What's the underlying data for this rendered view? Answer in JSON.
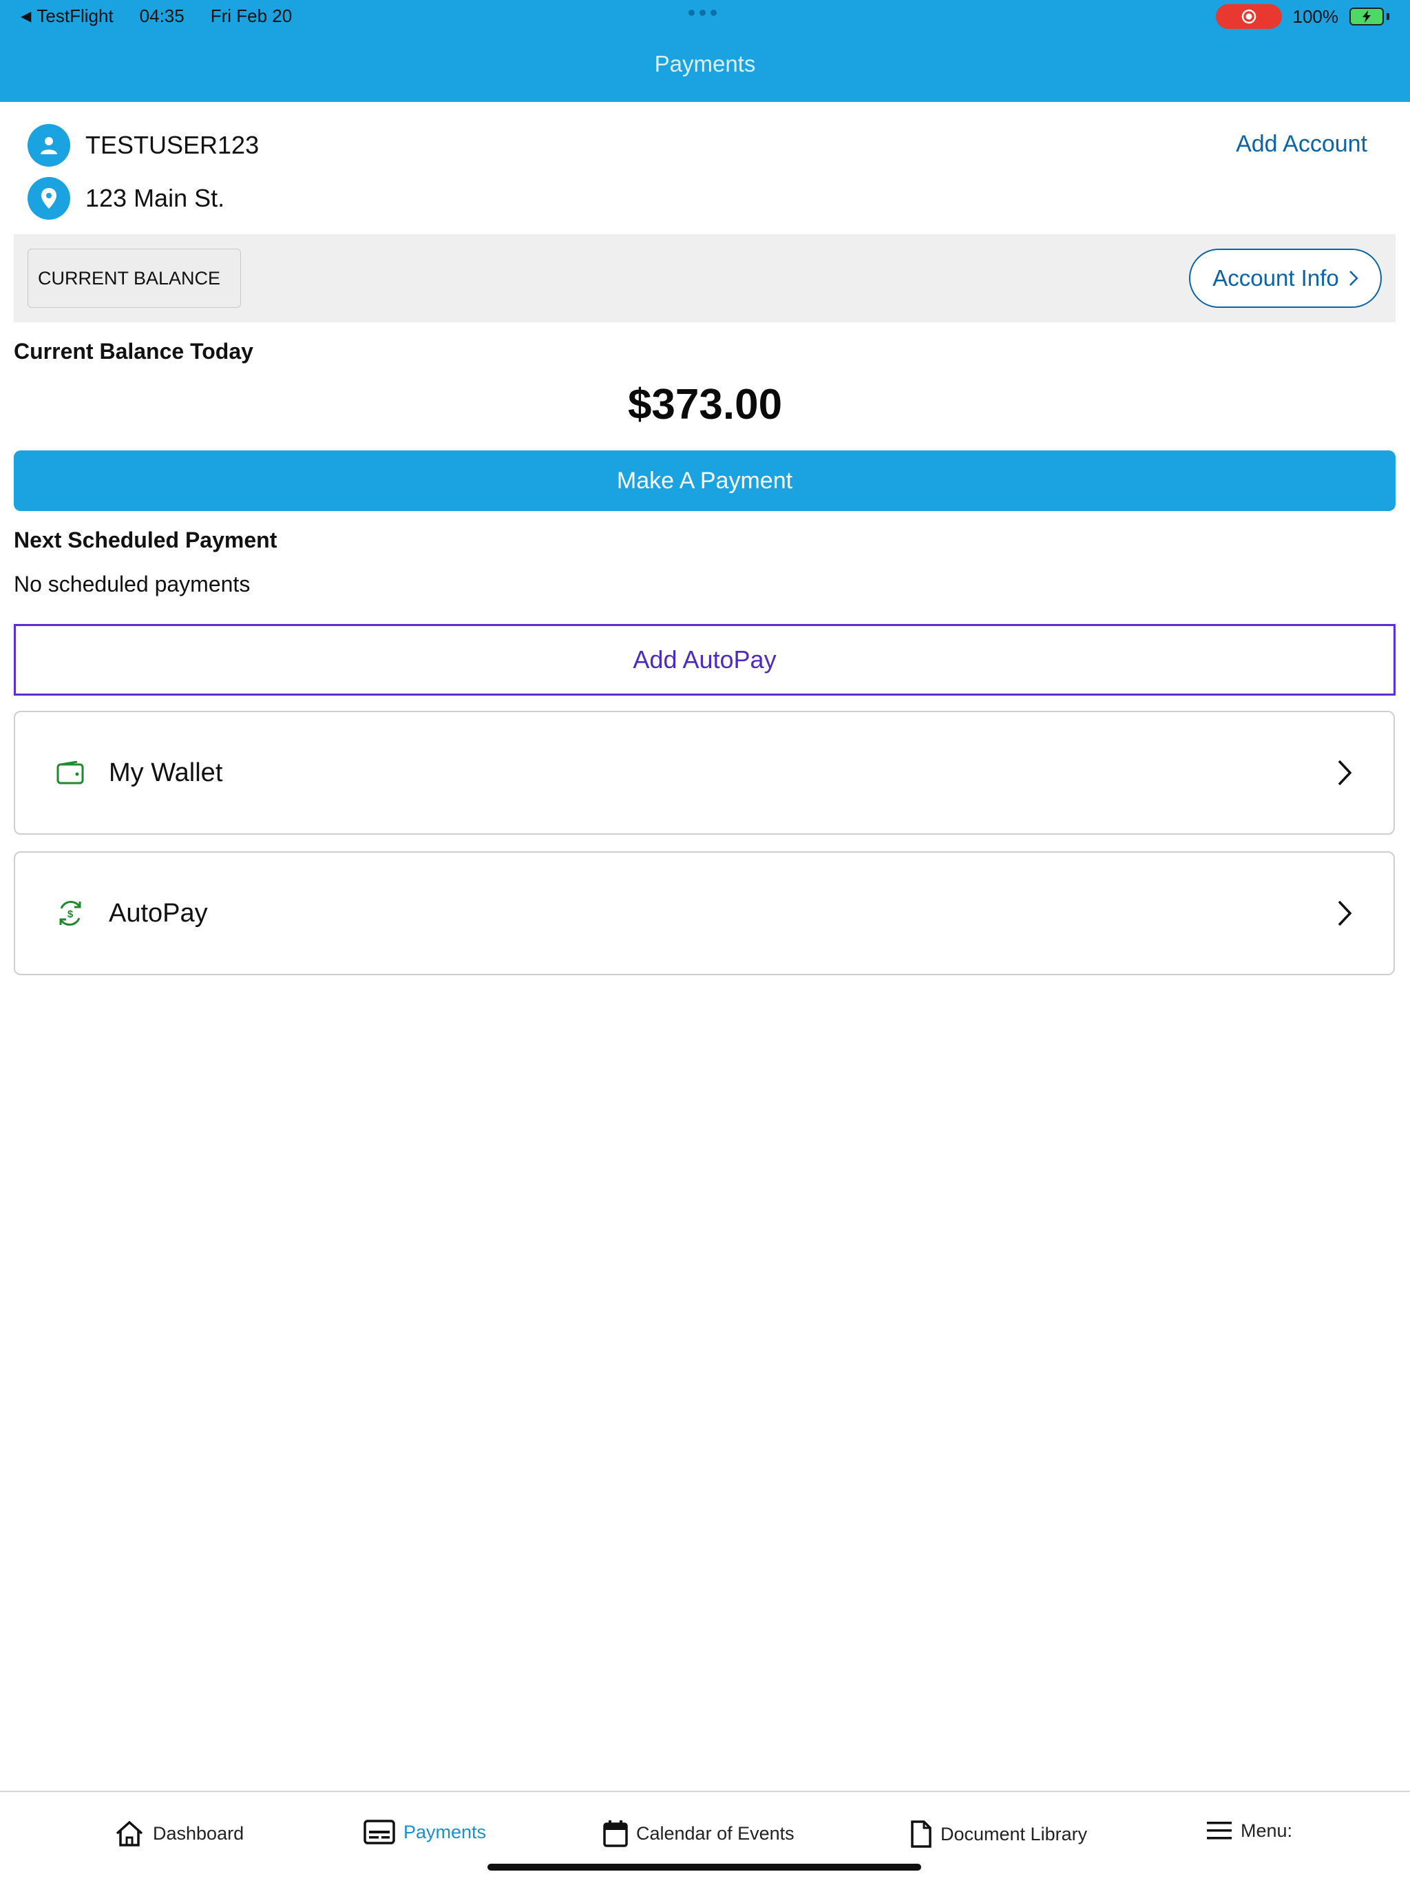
{
  "status_bar": {
    "back_app": "TestFlight",
    "time": "04:35",
    "date": "Fri Feb 20",
    "battery": "100%"
  },
  "header": {
    "title": "Payments"
  },
  "account": {
    "user": "TESTUSER123",
    "address": "123 Main St.",
    "add_account": "Add Account"
  },
  "balance_bar": {
    "chip": "CURRENT BALANCE",
    "account_info": "Account Info"
  },
  "balance": {
    "label": "Current Balance Today",
    "amount": "$373.00",
    "pay_button": "Make A Payment"
  },
  "scheduled": {
    "label": "Next Scheduled Payment",
    "value": "No scheduled payments",
    "autopay_button": "Add AutoPay"
  },
  "cards": [
    {
      "label": "My Wallet",
      "icon": "wallet-icon"
    },
    {
      "label": "AutoPay",
      "icon": "autopay-icon"
    }
  ],
  "tabs": [
    {
      "label": "Dashboard",
      "icon": "home-icon"
    },
    {
      "label": "Payments",
      "icon": "payments-icon"
    },
    {
      "label": "Calendar of Events",
      "icon": "calendar-icon"
    },
    {
      "label": "Document Library",
      "icon": "document-icon"
    },
    {
      "label": "Menu:",
      "icon": "menu-icon"
    }
  ],
  "colors": {
    "header": "#1aa3e0",
    "link": "#0b63a8",
    "autopay_outline": "#5c2fd6",
    "card_icon": "#1f8a2e",
    "active_tab": "#1a8fd1"
  }
}
